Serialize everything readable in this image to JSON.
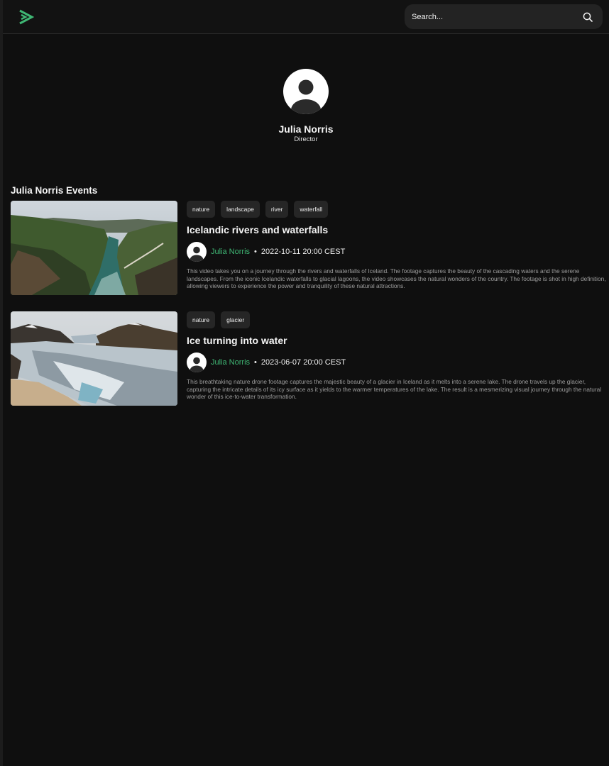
{
  "header": {
    "search_placeholder": "Search..."
  },
  "colors": {
    "accent": "#3fb774",
    "background": "#0f0f0f",
    "surface": "#232323"
  },
  "profile": {
    "name": "Julia Norris",
    "role": "Director"
  },
  "events_section": {
    "title": "Julia Norris Events"
  },
  "events": [
    {
      "tags": [
        "nature",
        "landscape",
        "river",
        "waterfall"
      ],
      "title": "Icelandic rivers and waterfalls",
      "author": "Julia Norris",
      "separator": "•",
      "datetime": "2022-10-11 20:00 CEST",
      "description": "This video takes you on a journey through the rivers and waterfalls of Iceland. The footage captures the beauty of the cascading waters and the serene landscapes. From the iconic Icelandic waterfalls to glacial lagoons, the video showcases the natural wonders of the country. The footage is shot in high definition, allowing viewers to experience the power and tranquility of these natural attractions."
    },
    {
      "tags": [
        "nature",
        "glacier"
      ],
      "title": "Ice turning into water",
      "author": "Julia Norris",
      "separator": "•",
      "datetime": "2023-06-07 20:00 CEST",
      "description": "This breathtaking nature drone footage captures the majestic beauty of a glacier in Iceland as it melts into a serene lake. The drone travels up the glacier, capturing the intricate details of its icy surface as it yields to the warmer temperatures of the lake. The result is a mesmerizing visual journey through the natural wonder of this ice-to-water transformation."
    }
  ]
}
